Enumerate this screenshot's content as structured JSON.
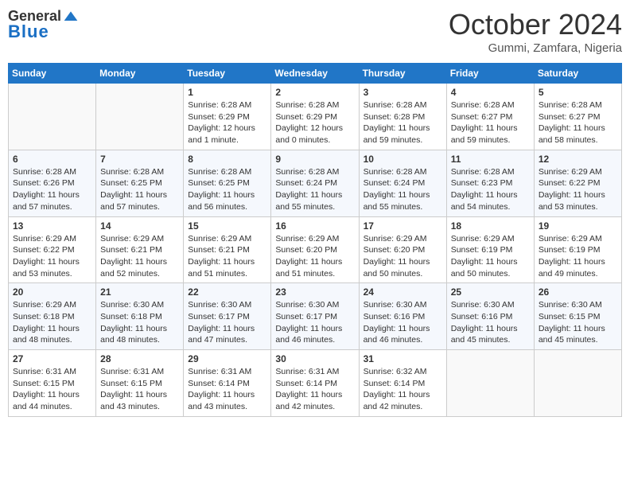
{
  "logo": {
    "general": "General",
    "blue": "Blue"
  },
  "header": {
    "month": "October 2024",
    "location": "Gummi, Zamfara, Nigeria"
  },
  "weekdays": [
    "Sunday",
    "Monday",
    "Tuesday",
    "Wednesday",
    "Thursday",
    "Friday",
    "Saturday"
  ],
  "weeks": [
    [
      {
        "day": "",
        "info": ""
      },
      {
        "day": "",
        "info": ""
      },
      {
        "day": "1",
        "info": "Sunrise: 6:28 AM\nSunset: 6:29 PM\nDaylight: 12 hours and 1 minute."
      },
      {
        "day": "2",
        "info": "Sunrise: 6:28 AM\nSunset: 6:29 PM\nDaylight: 12 hours and 0 minutes."
      },
      {
        "day": "3",
        "info": "Sunrise: 6:28 AM\nSunset: 6:28 PM\nDaylight: 11 hours and 59 minutes."
      },
      {
        "day": "4",
        "info": "Sunrise: 6:28 AM\nSunset: 6:27 PM\nDaylight: 11 hours and 59 minutes."
      },
      {
        "day": "5",
        "info": "Sunrise: 6:28 AM\nSunset: 6:27 PM\nDaylight: 11 hours and 58 minutes."
      }
    ],
    [
      {
        "day": "6",
        "info": "Sunrise: 6:28 AM\nSunset: 6:26 PM\nDaylight: 11 hours and 57 minutes."
      },
      {
        "day": "7",
        "info": "Sunrise: 6:28 AM\nSunset: 6:25 PM\nDaylight: 11 hours and 57 minutes."
      },
      {
        "day": "8",
        "info": "Sunrise: 6:28 AM\nSunset: 6:25 PM\nDaylight: 11 hours and 56 minutes."
      },
      {
        "day": "9",
        "info": "Sunrise: 6:28 AM\nSunset: 6:24 PM\nDaylight: 11 hours and 55 minutes."
      },
      {
        "day": "10",
        "info": "Sunrise: 6:28 AM\nSunset: 6:24 PM\nDaylight: 11 hours and 55 minutes."
      },
      {
        "day": "11",
        "info": "Sunrise: 6:28 AM\nSunset: 6:23 PM\nDaylight: 11 hours and 54 minutes."
      },
      {
        "day": "12",
        "info": "Sunrise: 6:29 AM\nSunset: 6:22 PM\nDaylight: 11 hours and 53 minutes."
      }
    ],
    [
      {
        "day": "13",
        "info": "Sunrise: 6:29 AM\nSunset: 6:22 PM\nDaylight: 11 hours and 53 minutes."
      },
      {
        "day": "14",
        "info": "Sunrise: 6:29 AM\nSunset: 6:21 PM\nDaylight: 11 hours and 52 minutes."
      },
      {
        "day": "15",
        "info": "Sunrise: 6:29 AM\nSunset: 6:21 PM\nDaylight: 11 hours and 51 minutes."
      },
      {
        "day": "16",
        "info": "Sunrise: 6:29 AM\nSunset: 6:20 PM\nDaylight: 11 hours and 51 minutes."
      },
      {
        "day": "17",
        "info": "Sunrise: 6:29 AM\nSunset: 6:20 PM\nDaylight: 11 hours and 50 minutes."
      },
      {
        "day": "18",
        "info": "Sunrise: 6:29 AM\nSunset: 6:19 PM\nDaylight: 11 hours and 50 minutes."
      },
      {
        "day": "19",
        "info": "Sunrise: 6:29 AM\nSunset: 6:19 PM\nDaylight: 11 hours and 49 minutes."
      }
    ],
    [
      {
        "day": "20",
        "info": "Sunrise: 6:29 AM\nSunset: 6:18 PM\nDaylight: 11 hours and 48 minutes."
      },
      {
        "day": "21",
        "info": "Sunrise: 6:30 AM\nSunset: 6:18 PM\nDaylight: 11 hours and 48 minutes."
      },
      {
        "day": "22",
        "info": "Sunrise: 6:30 AM\nSunset: 6:17 PM\nDaylight: 11 hours and 47 minutes."
      },
      {
        "day": "23",
        "info": "Sunrise: 6:30 AM\nSunset: 6:17 PM\nDaylight: 11 hours and 46 minutes."
      },
      {
        "day": "24",
        "info": "Sunrise: 6:30 AM\nSunset: 6:16 PM\nDaylight: 11 hours and 46 minutes."
      },
      {
        "day": "25",
        "info": "Sunrise: 6:30 AM\nSunset: 6:16 PM\nDaylight: 11 hours and 45 minutes."
      },
      {
        "day": "26",
        "info": "Sunrise: 6:30 AM\nSunset: 6:15 PM\nDaylight: 11 hours and 45 minutes."
      }
    ],
    [
      {
        "day": "27",
        "info": "Sunrise: 6:31 AM\nSunset: 6:15 PM\nDaylight: 11 hours and 44 minutes."
      },
      {
        "day": "28",
        "info": "Sunrise: 6:31 AM\nSunset: 6:15 PM\nDaylight: 11 hours and 43 minutes."
      },
      {
        "day": "29",
        "info": "Sunrise: 6:31 AM\nSunset: 6:14 PM\nDaylight: 11 hours and 43 minutes."
      },
      {
        "day": "30",
        "info": "Sunrise: 6:31 AM\nSunset: 6:14 PM\nDaylight: 11 hours and 42 minutes."
      },
      {
        "day": "31",
        "info": "Sunrise: 6:32 AM\nSunset: 6:14 PM\nDaylight: 11 hours and 42 minutes."
      },
      {
        "day": "",
        "info": ""
      },
      {
        "day": "",
        "info": ""
      }
    ]
  ]
}
